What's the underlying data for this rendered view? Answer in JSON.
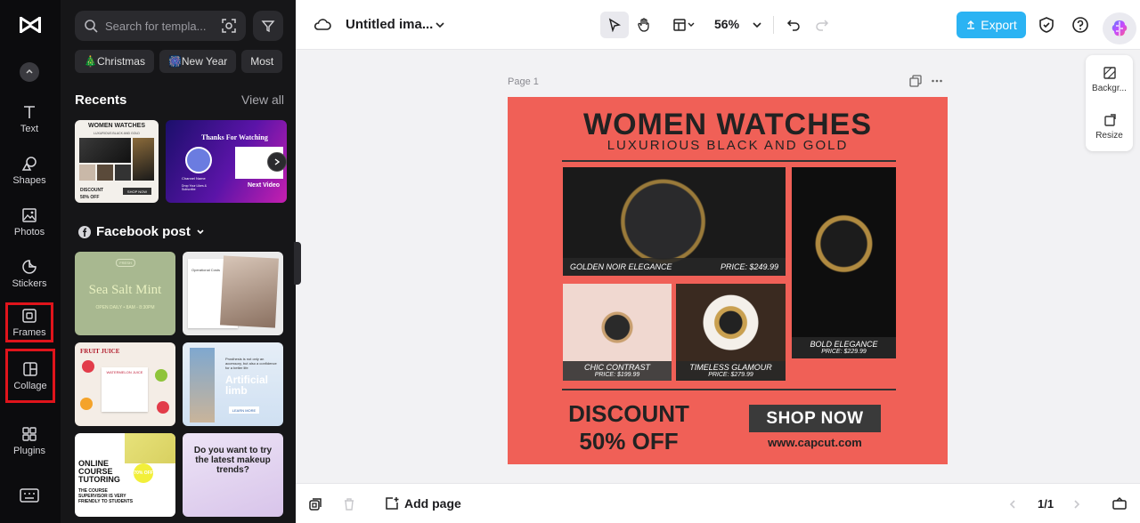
{
  "rail": {
    "items": [
      {
        "label": "Text"
      },
      {
        "label": "Shapes"
      },
      {
        "label": "Photos"
      },
      {
        "label": "Stickers"
      },
      {
        "label": "Frames"
      },
      {
        "label": "Collage"
      },
      {
        "label": "Plugins"
      }
    ]
  },
  "panel": {
    "search_placeholder": "Search for templa...",
    "chips": [
      "🎄Christmas",
      "🎆New Year",
      "Most"
    ],
    "recents_title": "Recents",
    "view_all": "View all",
    "facebook_title": "Facebook post",
    "recent_thumbs": [
      {
        "title": "WOMEN WATCHES",
        "sub": "LUXURIOUS BLACK AND GOLD",
        "discount": "DISCOUNT",
        "off": "50% OFF",
        "shop": "SHOP NOW"
      },
      {
        "title": "Thanks For Watching",
        "name": "Channel Name",
        "cta": "Drop Your Likes & Subscribe",
        "next": "Next Video"
      }
    ],
    "templates": [
      {
        "title": "Sea Salt Mint",
        "sub": "OPEN DAILY • 8AM - 8:30PM",
        "tag": "FRESH"
      },
      {
        "title": "Operational Costs"
      },
      {
        "title": "FRUIT JUICE",
        "sub": "WATERMELON JUICE"
      },
      {
        "title": "Artificial limb",
        "sub": "Prosthesis is not only an accessory, but also a confidence for a better life",
        "cta": "LEARN MORE"
      },
      {
        "title": "ONLINE COURSE TUTORING",
        "badge": "70% OFF",
        "sub": "THE COURSE SUPERVISOR IS VERY FRIENDLY TO STUDENTS"
      },
      {
        "title": "Do you want to try the latest makeup trends?"
      }
    ]
  },
  "topbar": {
    "doc_title": "Untitled ima...",
    "zoom": "56%",
    "export": "Export"
  },
  "rpanel": {
    "background": "Backgr...",
    "resize": "Resize"
  },
  "canvas": {
    "page_label": "Page 1"
  },
  "poster": {
    "title": "WOMEN WATCHES",
    "subtitle": "LUXURIOUS BLACK AND GOLD",
    "captions": [
      {
        "name": "GOLDEN NOIR ELEGANCE",
        "price": "PRICE: $249.99"
      },
      {
        "name": "CHIC CONTRAST",
        "price": "PRICE: $199.99"
      },
      {
        "name": "TIMELESS GLAMOUR",
        "price": "PRICE: $279.99"
      },
      {
        "name": "BOLD ELEGANCE",
        "price": "PRICE: $229.99"
      }
    ],
    "discount_line1": "DISCOUNT",
    "discount_line2": "50% OFF",
    "shop": "SHOP NOW",
    "url": "www.capcut.com",
    "background_color": "#f06057"
  },
  "bottombar": {
    "add_page": "Add page",
    "page_count": "1/1"
  }
}
